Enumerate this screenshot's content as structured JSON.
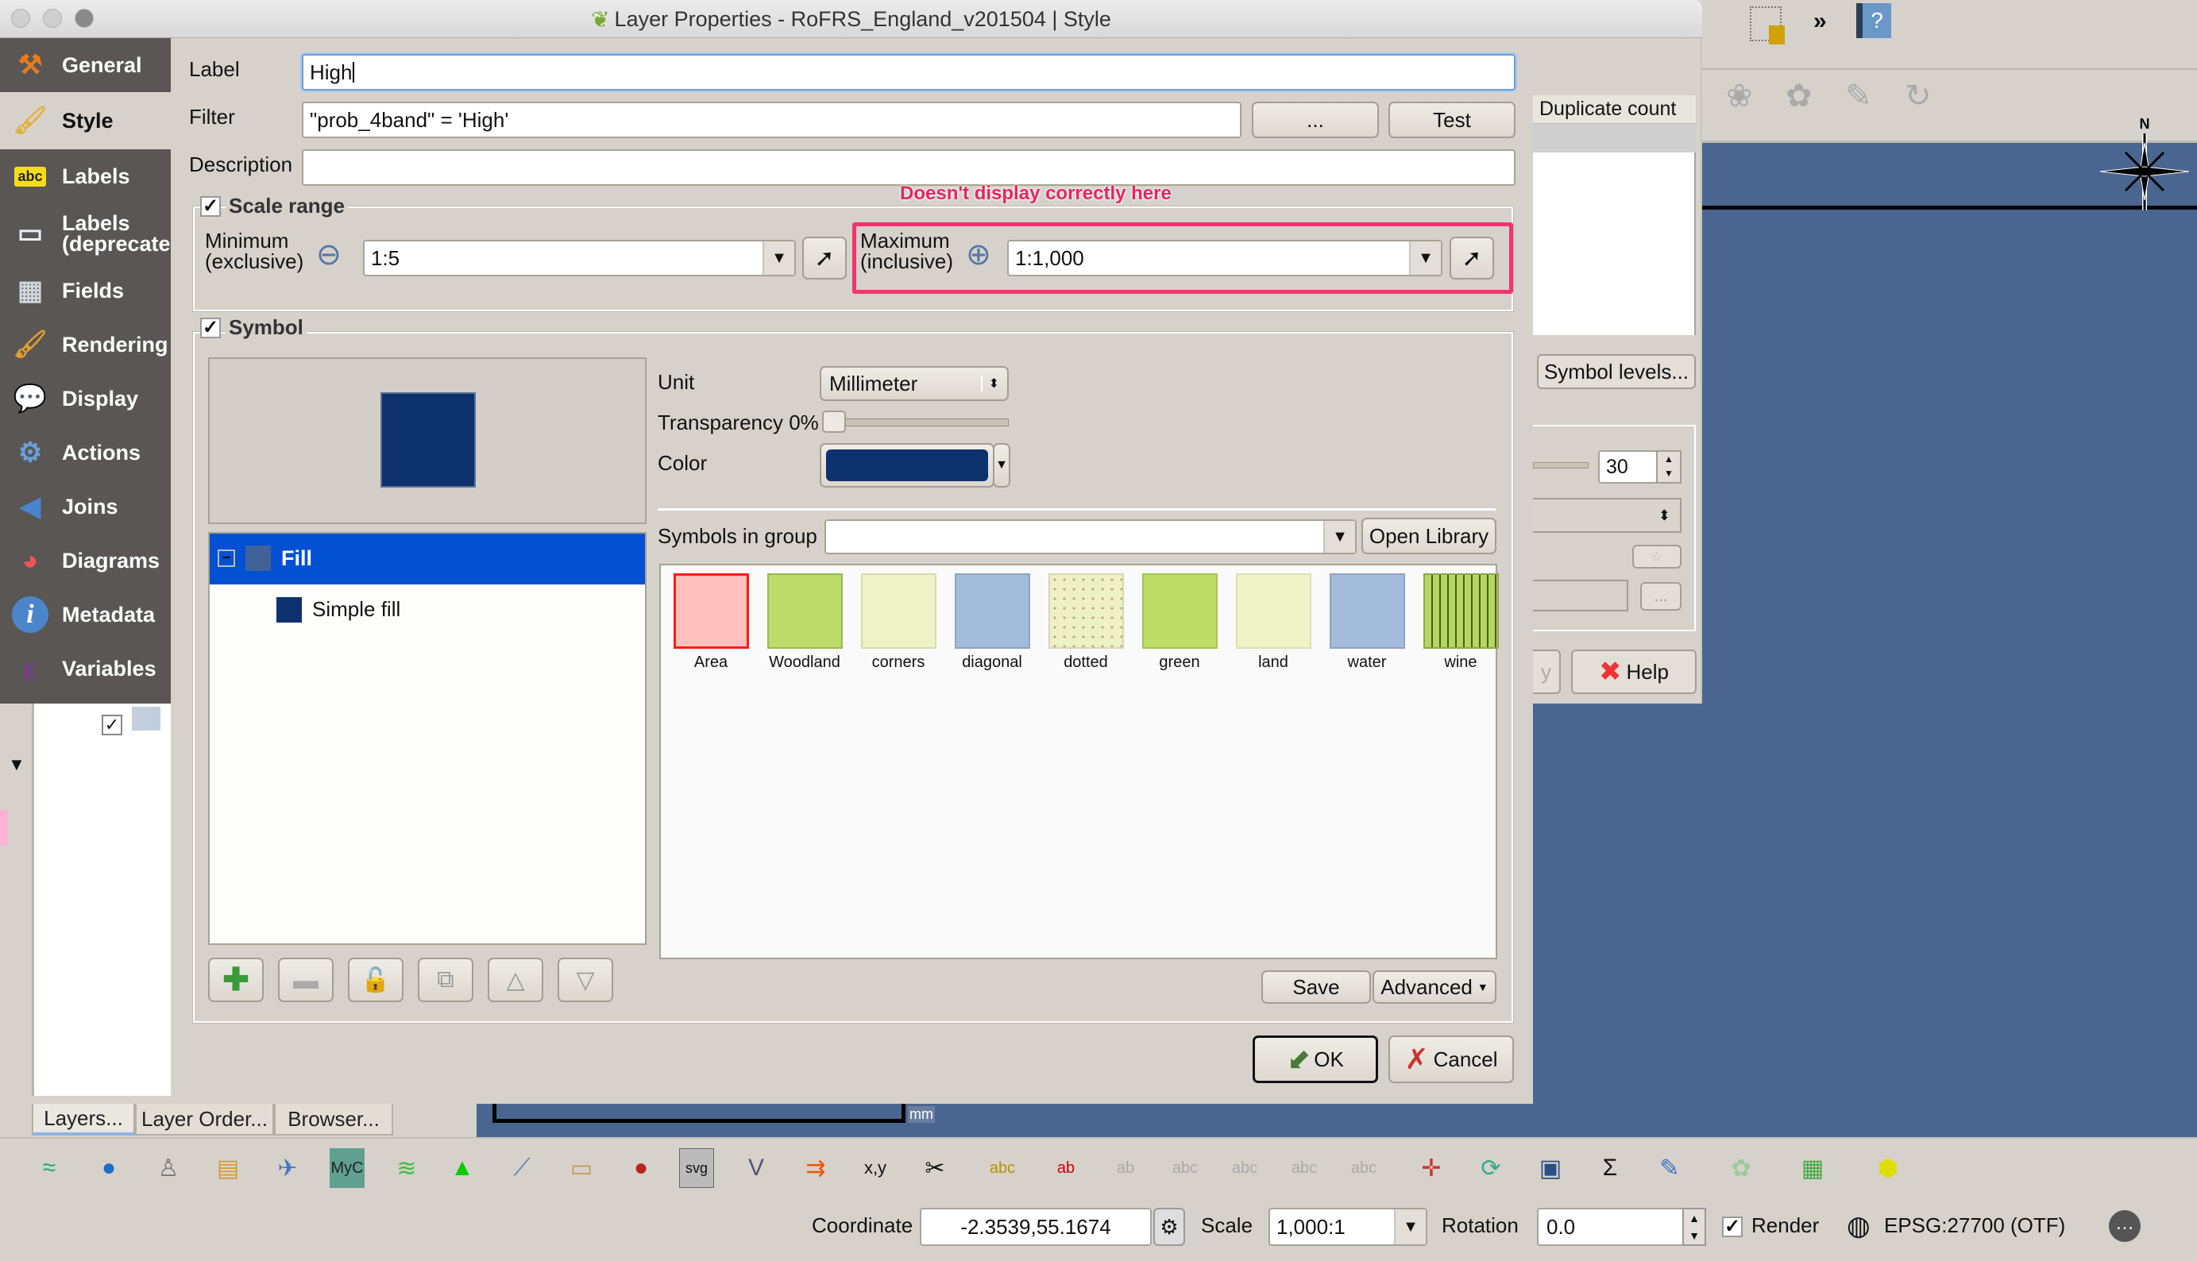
{
  "window": {
    "title": "Layer Properties - RoFRS_England_v201504 | Style",
    "title_icon": "qgis-leaf-icon"
  },
  "sidebar": {
    "items": [
      {
        "label": "General",
        "icon": "tools-icon",
        "selected": false
      },
      {
        "label": "Style",
        "icon": "paintbrush-icon",
        "selected": true
      },
      {
        "label": "Labels",
        "icon": "abc-label-icon",
        "selected": false
      },
      {
        "label": "Labels (deprecated)",
        "icon": "label-tag-icon",
        "selected": false
      },
      {
        "label": "Fields",
        "icon": "table-icon",
        "selected": false
      },
      {
        "label": "Rendering",
        "icon": "brush-icon",
        "selected": false
      },
      {
        "label": "Display",
        "icon": "speech-bubble-icon",
        "selected": false
      },
      {
        "label": "Actions",
        "icon": "gear-play-icon",
        "selected": false
      },
      {
        "label": "Joins",
        "icon": "join-arrow-icon",
        "selected": false
      },
      {
        "label": "Diagrams",
        "icon": "pie-chart-icon",
        "selected": false
      },
      {
        "label": "Metadata",
        "icon": "info-icon",
        "selected": false
      },
      {
        "label": "Variables",
        "icon": "epsilon-icon",
        "selected": false
      }
    ]
  },
  "rule": {
    "label_caption": "Label",
    "label_value": "High",
    "filter_caption": "Filter",
    "filter_value": "\"prob_4band\" = 'High'",
    "filter_expr_button": "...",
    "test_button": "Test",
    "description_caption": "Description",
    "description_value": ""
  },
  "scale_range": {
    "title": "Scale range",
    "checked": true,
    "min_label_1": "Minimum",
    "min_label_2": "(exclusive)",
    "min_value": "1:5",
    "max_label_1": "Maximum",
    "max_label_2": "(inclusive)",
    "max_value": "1:1,000"
  },
  "annotation": {
    "text": "Doesn't display correctly here",
    "color": "#f2336f"
  },
  "symbol": {
    "title": "Symbol",
    "checked": true,
    "preview_color": "#0d326e",
    "tree": {
      "root": "Fill",
      "child": "Simple fill"
    },
    "unit_label": "Unit",
    "unit_value": "Millimeter",
    "transparency_label": "Transparency 0%",
    "transparency_percent": 0,
    "color_label": "Color",
    "color_value": "#0d326e",
    "symbols_in_group_label": "Symbols in group",
    "symbols_in_group_value": "",
    "open_library_button": "Open Library",
    "library": [
      {
        "name": "Area",
        "fill": "#ffc0bd",
        "border": "#ff1a1a"
      },
      {
        "name": "Woodland",
        "fill": "#bcdb68",
        "border": "#9ab850"
      },
      {
        "name": "corners",
        "fill": "#edf3c4",
        "border": "#d6dba8"
      },
      {
        "name": "diagonal",
        "fill": "#a4bcdc",
        "border": "#8ea3c2"
      },
      {
        "name": "dotted",
        "fill": "#eef1c6",
        "border": "#d9d6b0"
      },
      {
        "name": "green",
        "fill": "#bddd68",
        "border": "#a3c552"
      },
      {
        "name": "land",
        "fill": "#eef4c8",
        "border": "#dbe1b2"
      },
      {
        "name": "water",
        "fill": "#a4bcdc",
        "border": "#8ea3c2"
      },
      {
        "name": "wine",
        "fill": "#b5d760",
        "border": "#8aa846"
      }
    ],
    "save_button": "Save",
    "advanced_button": "Advanced",
    "layer_buttons": [
      "add-layer-icon",
      "remove-layer-icon",
      "lock-icon",
      "duplicate-layer-icon",
      "move-up-icon",
      "move-down-icon"
    ]
  },
  "dialog_buttons": {
    "ok": "OK",
    "cancel": "Cancel"
  },
  "back_dialog": {
    "column_header": "Duplicate count",
    "symbol_levels_button": "Symbol levels...",
    "spin_value": "30",
    "ellipsis_button": "...",
    "help_button": "Help",
    "apply_button_partial": "y"
  },
  "panels": {
    "tabs": [
      "Layers...",
      "Layer Order...",
      "Browser..."
    ],
    "active_tab": "Layers..."
  },
  "map": {
    "background_color": "#4a6690",
    "scalebar_unit": "mm",
    "north_label": "N"
  },
  "top_toolbar": {
    "overflow": "»",
    "help_icon": "?"
  },
  "statusbar": {
    "coordinate_label": "Coordinate",
    "coordinate_value": "-2.3539,55.1674",
    "scale_label": "Scale",
    "scale_value": "1,000:1",
    "rotation_label": "Rotation",
    "rotation_value": "0.0",
    "render_label": "Render",
    "render_checked": true,
    "crs_label": "EPSG:27700 (OTF)"
  }
}
